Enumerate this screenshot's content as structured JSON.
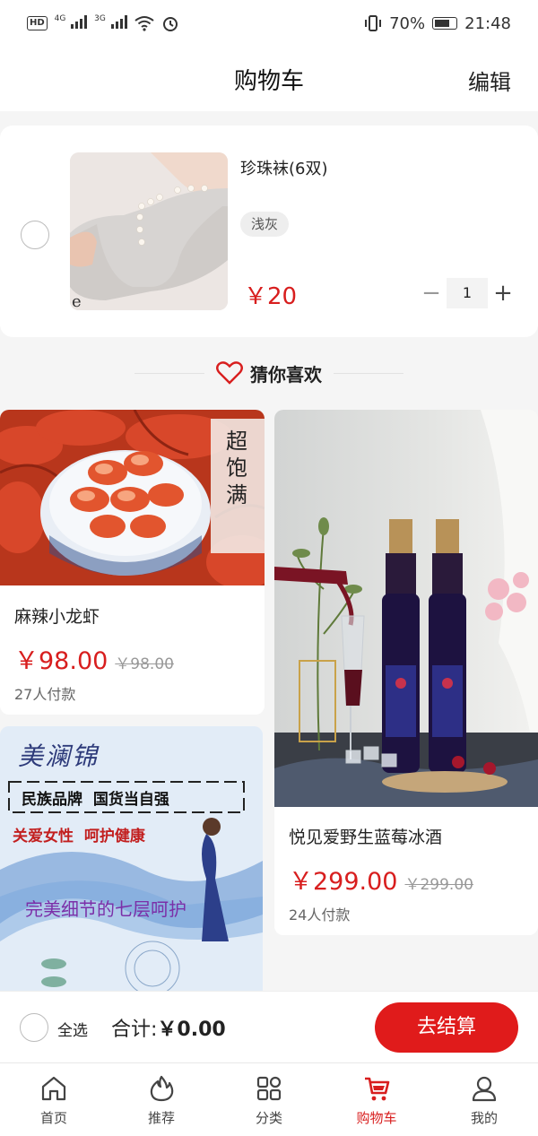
{
  "status_bar": {
    "hd": "HD",
    "net1": "4G",
    "net2": "3G",
    "battery": "70%",
    "time": "21:48"
  },
  "header": {
    "title": "购物车",
    "edit_label": "编辑"
  },
  "cart": {
    "items": [
      {
        "name": "珍珠袜(6双)",
        "spec": "浅灰",
        "price": "￥20",
        "quantity": "1",
        "minus": "−",
        "plus": "+"
      }
    ]
  },
  "guess": {
    "title": "猜你喜欢",
    "products": [
      {
        "image_text": "超饱满",
        "name": "麻辣小龙虾",
        "price": "￥98.00",
        "old_price": "￥98.00",
        "sold": "27人付款"
      },
      {
        "image_text": "",
        "name": "悦见爱野生蓝莓冰酒",
        "price": "￥299.00",
        "old_price": "￥299.00",
        "sold": "24人付款"
      },
      {
        "image_text": {
          "brand": "美澜锦",
          "line1": "民族品牌  国货当自强",
          "line2": "关爱女性  呵护健康",
          "line3": "完美细节的七层呵护"
        }
      }
    ]
  },
  "checkout": {
    "select_all": "全选",
    "total_label": "合计:",
    "total_value": "￥0.00",
    "checkout_button": "去结算"
  },
  "tabbar": {
    "items": [
      {
        "label": "首页",
        "icon": "home-icon"
      },
      {
        "label": "推荐",
        "icon": "flame-icon"
      },
      {
        "label": "分类",
        "icon": "grid-icon"
      },
      {
        "label": "购物车",
        "icon": "cart-icon",
        "active": true
      },
      {
        "label": "我的",
        "icon": "user-icon"
      }
    ]
  },
  "colors": {
    "accent": "#d81e1e",
    "button": "#e01b1b",
    "background": "#f5f5f5"
  }
}
